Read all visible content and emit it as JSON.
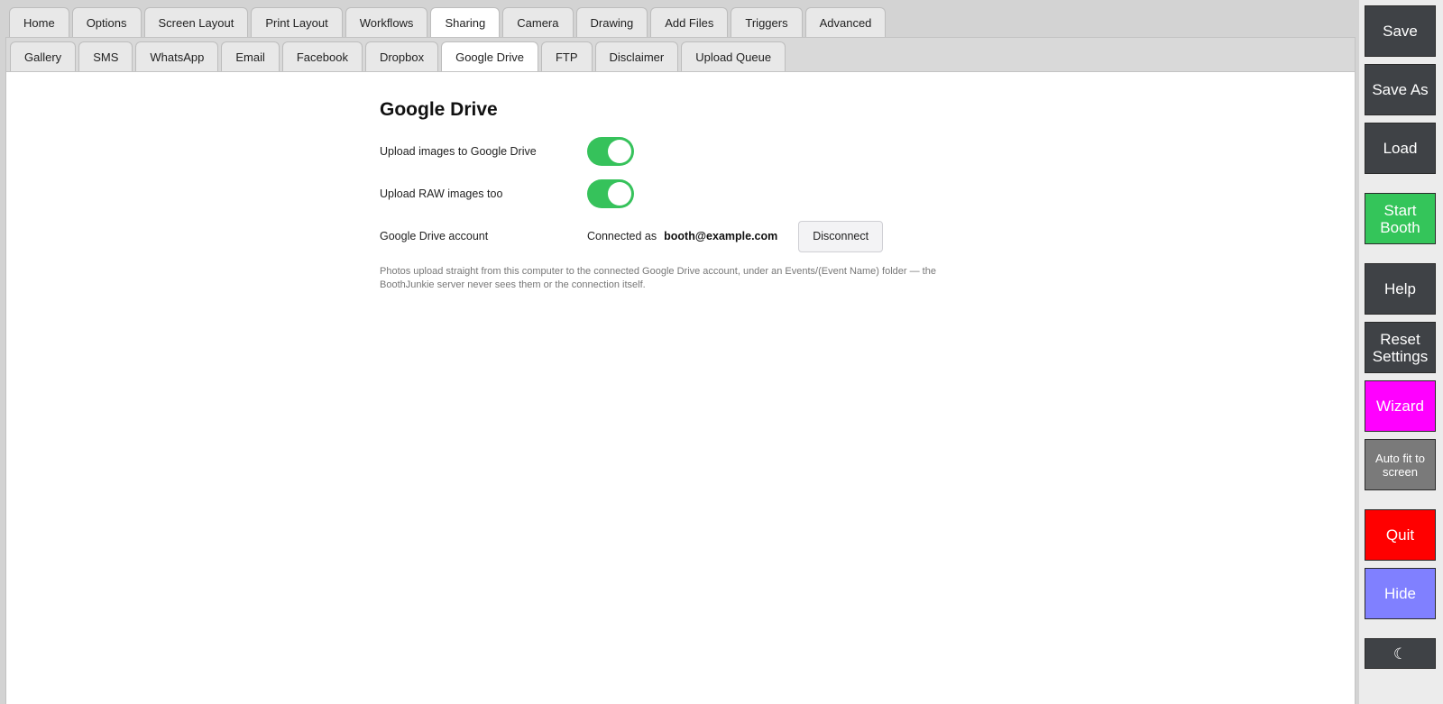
{
  "top_tabs": [
    "Home",
    "Options",
    "Screen Layout",
    "Print Layout",
    "Workflows",
    "Sharing",
    "Camera",
    "Drawing",
    "Add Files",
    "Triggers",
    "Advanced"
  ],
  "top_active": 5,
  "sub_tabs": [
    "Gallery",
    "SMS",
    "WhatsApp",
    "Email",
    "Facebook",
    "Dropbox",
    "Google Drive",
    "FTP",
    "Disclaimer",
    "Upload Queue"
  ],
  "sub_active": 6,
  "panel": {
    "title": "Google Drive",
    "upload_images_label": "Upload images to Google Drive",
    "upload_images_on": true,
    "upload_raw_label": "Upload RAW images too",
    "upload_raw_on": true,
    "account_label": "Google Drive account",
    "connected_prefix": "Connected as",
    "account_email": "booth@example.com",
    "disconnect_label": "Disconnect",
    "note": "Photos upload straight from this computer to the connected Google Drive account, under an Events/(Event Name) folder — the BoothJunkie server never sees them or the connection itself."
  },
  "side_buttons": [
    {
      "label": "Save",
      "color": "#3f4246"
    },
    {
      "label": "Save As",
      "color": "#3f4246"
    },
    {
      "label": "Load",
      "color": "#3f4246"
    },
    {
      "label": "Start\nBooth",
      "color": "#34c55a"
    },
    {
      "label": "Help",
      "color": "#3f4246"
    },
    {
      "label": "Reset\nSettings",
      "color": "#3f4246"
    },
    {
      "label": "Wizard",
      "color": "#ff00ff"
    },
    {
      "label": "Auto fit to\nscreen",
      "color": "#7a7a7a"
    },
    {
      "label": "Quit",
      "color": "#ff0000"
    },
    {
      "label": "Hide",
      "color": "#8080ff"
    },
    {
      "label": "☾",
      "color": "#3f4246"
    }
  ]
}
